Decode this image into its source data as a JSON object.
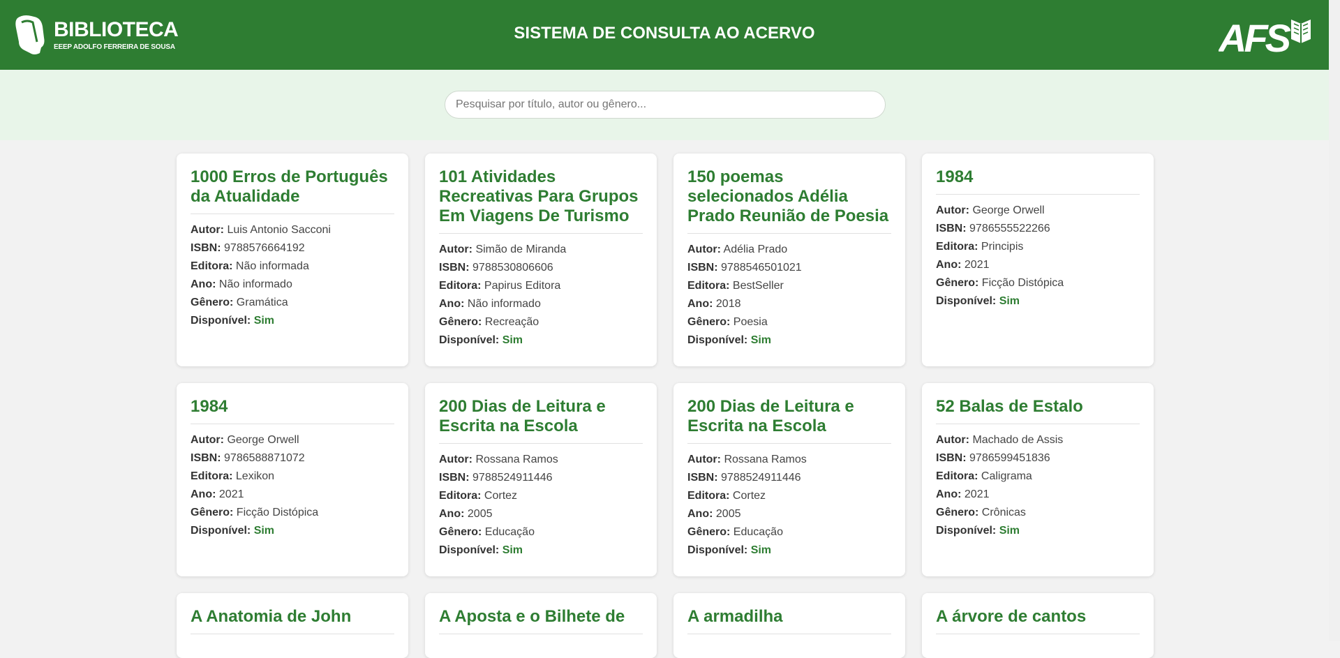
{
  "header": {
    "logo_title": "BIBLIOTECA",
    "logo_subtitle": "EEEP ADOLFO FERREIRA DE SOUSA",
    "title": "SISTEMA DE CONSULTA AO ACERVO",
    "right_logo_text": "AFS",
    "brand_color": "#2e7d32"
  },
  "search": {
    "placeholder": "Pesquisar por título, autor ou gênero...",
    "value": ""
  },
  "labels": {
    "autor": "Autor:",
    "isbn": "ISBN:",
    "editora": "Editora:",
    "ano": "Ano:",
    "genero": "Gênero:",
    "disponivel": "Disponível:"
  },
  "books": [
    {
      "title": "1000 Erros de Português da Atualidade",
      "autor": "Luis Antonio Sacconi",
      "isbn": "9788576664192",
      "editora": "Não informada",
      "ano": "Não informado",
      "genero": "Gramática",
      "disponivel": "Sim"
    },
    {
      "title": "101 Atividades Recreativas Para Grupos Em Viagens De Turismo",
      "autor": "Simão de Miranda",
      "isbn": "9788530806606",
      "editora": "Papirus Editora",
      "ano": "Não informado",
      "genero": "Recreação",
      "disponivel": "Sim"
    },
    {
      "title": "150 poemas selecionados Adélia Prado Reunião de Poesia",
      "autor": "Adélia Prado",
      "isbn": "9788546501021",
      "editora": "BestSeller",
      "ano": "2018",
      "genero": "Poesia",
      "disponivel": "Sim"
    },
    {
      "title": "1984",
      "autor": "George Orwell",
      "isbn": "9786555522266",
      "editora": "Principis",
      "ano": "2021",
      "genero": "Ficção Distópica",
      "disponivel": "Sim"
    },
    {
      "title": "1984",
      "autor": "George Orwell",
      "isbn": "9786588871072",
      "editora": "Lexikon",
      "ano": "2021",
      "genero": "Ficção Distópica",
      "disponivel": "Sim"
    },
    {
      "title": "200 Dias de Leitura e Escrita na Escola",
      "autor": "Rossana Ramos",
      "isbn": "9788524911446",
      "editora": "Cortez",
      "ano": "2005",
      "genero": "Educação",
      "disponivel": "Sim"
    },
    {
      "title": "200 Dias de Leitura e Escrita na Escola",
      "autor": "Rossana Ramos",
      "isbn": "9788524911446",
      "editora": "Cortez",
      "ano": "2005",
      "genero": "Educação",
      "disponivel": "Sim"
    },
    {
      "title": "52 Balas de Estalo",
      "autor": "Machado de Assis",
      "isbn": "9786599451836",
      "editora": "Caligrama",
      "ano": "2021",
      "genero": "Crônicas",
      "disponivel": "Sim"
    },
    {
      "title": "A Anatomia de John"
    },
    {
      "title": "A Aposta e o Bilhete de"
    },
    {
      "title": "A armadilha"
    },
    {
      "title": "A árvore de cantos"
    }
  ]
}
